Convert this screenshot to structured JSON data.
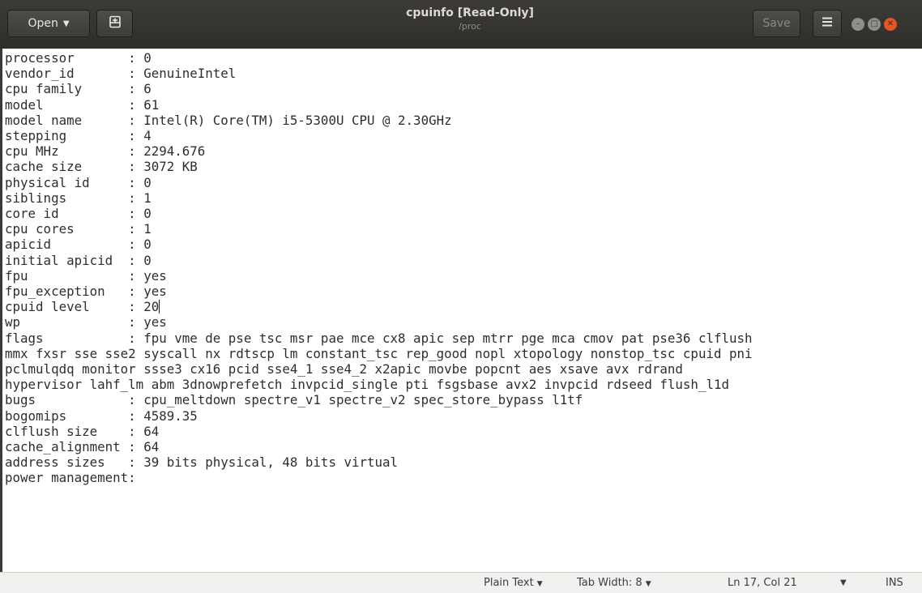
{
  "window": {
    "title": "cpuinfo [Read-Only]",
    "subtitle": "/proc"
  },
  "toolbar": {
    "open_label": "Open",
    "open_icon": "chevron-down-icon",
    "new_tab_icon": "new-document-icon",
    "save_label": "Save",
    "menu_icon": "hamburger-menu-icon",
    "window_controls": [
      "minimize-icon",
      "maximize-icon",
      "close-icon"
    ]
  },
  "document": {
    "lines": [
      "processor       : 0",
      "vendor_id       : GenuineIntel",
      "cpu family      : 6",
      "model           : 61",
      "model name      : Intel(R) Core(TM) i5-5300U CPU @ 2.30GHz",
      "stepping        : 4",
      "cpu MHz         : 2294.676",
      "cache size      : 3072 KB",
      "physical id     : 0",
      "siblings        : 1",
      "core id         : 0",
      "cpu cores       : 1",
      "apicid          : 0",
      "initial apicid  : 0",
      "fpu             : yes",
      "fpu_exception   : yes",
      "cpuid level     : 20",
      "wp              : yes",
      "flags           : fpu vme de pse tsc msr pae mce cx8 apic sep mtrr pge mca cmov pat pse36 clflush",
      "mmx fxsr sse sse2 syscall nx rdtscp lm constant_tsc rep_good nopl xtopology nonstop_tsc cpuid pni",
      "pclmulqdq monitor ssse3 cx16 pcid sse4_1 sse4_2 x2apic movbe popcnt aes xsave avx rdrand",
      "hypervisor lahf_lm abm 3dnowprefetch invpcid_single pti fsgsbase avx2 invpcid rdseed flush_l1d",
      "bugs            : cpu_meltdown spectre_v1 spectre_v2 spec_store_bypass l1tf",
      "bogomips        : 4589.35",
      "clflush size    : 64",
      "cache_alignment : 64",
      "address sizes   : 39 bits physical, 48 bits virtual",
      "power management:"
    ]
  },
  "statusbar": {
    "language": "Plain Text",
    "tab_width": "Tab Width: 8",
    "position": "Ln 17, Col 21",
    "mode": "INS"
  }
}
